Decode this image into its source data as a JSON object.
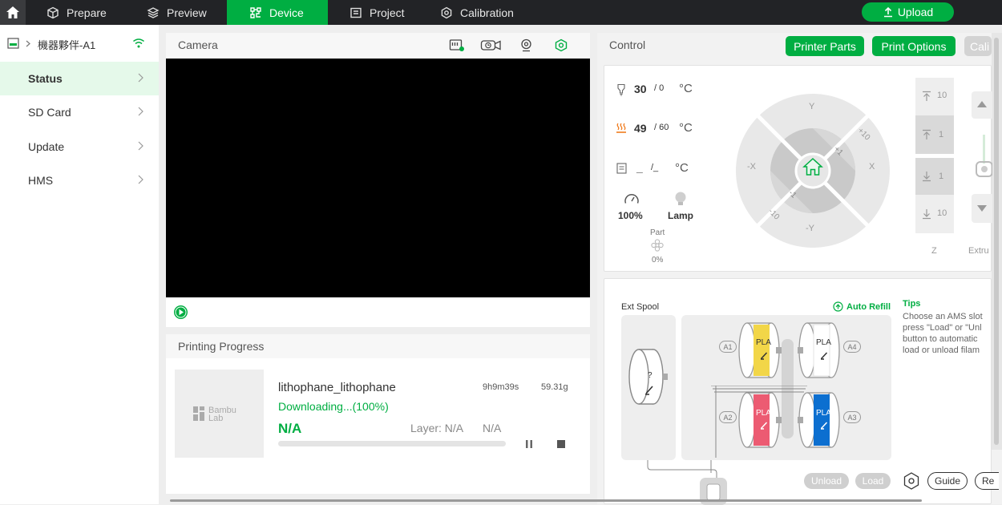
{
  "topbar": {
    "tabs": [
      {
        "label": "Prepare"
      },
      {
        "label": "Preview"
      },
      {
        "label": "Device"
      },
      {
        "label": "Project"
      },
      {
        "label": "Calibration"
      }
    ],
    "upload_label": "Upload",
    "accent": "#00ae42"
  },
  "sidebar": {
    "device_name": "機器夥伴-A1",
    "items": [
      {
        "label": "Status"
      },
      {
        "label": "SD Card"
      },
      {
        "label": "Update"
      },
      {
        "label": "HMS"
      }
    ]
  },
  "camera": {
    "title": "Camera"
  },
  "progress": {
    "title": "Printing Progress",
    "thumb_logo_line1": "Bambu",
    "thumb_logo_line2": "Lab",
    "file_name": "lithophane_lithophane",
    "time": "9h9m39s",
    "weight": "59.31g",
    "status": "Downloading...(100%)",
    "percent": "N/A",
    "layer": "Layer: N/A",
    "remaining": "N/A",
    "fraction": 0
  },
  "control": {
    "title": "Control",
    "buttons": {
      "printer_parts": "Printer Parts",
      "print_options": "Print Options",
      "calibration": "Cali"
    },
    "nozzle": {
      "current": "30",
      "target": "/ 0",
      "unit": "°C"
    },
    "bed": {
      "current": "49",
      "target": "/ 60",
      "unit": "°C"
    },
    "chamber": {
      "current": "_",
      "target": "/_",
      "unit": "°C"
    },
    "speed": "100%",
    "lamp": "Lamp",
    "part_fan": {
      "label": "Part",
      "value": "0%"
    },
    "jog": {
      "y": "Y",
      "neg_y": "-Y",
      "x": "X",
      "neg_x": "-X",
      "p10": "+10",
      "p1": "+1",
      "m1": "-1",
      "m10": "-10"
    },
    "z": {
      "up10": "10",
      "up1": "1",
      "down1": "1",
      "down10": "10",
      "label": "Z"
    },
    "extruder_label": "Extru"
  },
  "ams": {
    "ext_spool": "Ext Spool",
    "auto_refill": "Auto Refill",
    "unknown_mark": "?",
    "slots": [
      {
        "id": "A1",
        "material": "PLA",
        "color": "#f2d648"
      },
      {
        "id": "A4",
        "material": "PLA",
        "color": "#ffffff"
      },
      {
        "id": "A2",
        "material": "PLA",
        "color": "#ec5b72"
      },
      {
        "id": "A3",
        "material": "PLA",
        "color": "#0c6fd0"
      }
    ],
    "tips_title": "Tips",
    "tips_lines": [
      "Choose an AMS slot",
      "press \"Load\" or \"Unl",
      "button to automatic",
      "load or unload filam"
    ],
    "unload": "Unload",
    "load": "Load",
    "guide": "Guide",
    "retry": "Re"
  }
}
